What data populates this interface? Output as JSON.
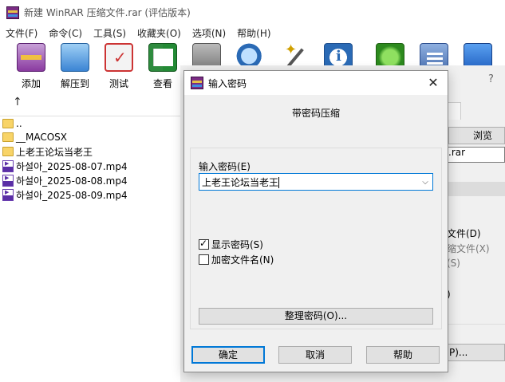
{
  "window": {
    "title": "新建 WinRAR 压缩文件.rar (评估版本)"
  },
  "menu": [
    "文件(F)",
    "命令(C)",
    "工具(S)",
    "收藏夹(O)",
    "选项(N)",
    "帮助(H)"
  ],
  "toolbar": {
    "add": "添加",
    "extract": "解压到",
    "test": "测试",
    "view": "查看"
  },
  "files": [
    {
      "name": "..",
      "type": "folder"
    },
    {
      "name": "__MACOSX",
      "type": "folder"
    },
    {
      "name": "上老王论坛当老王",
      "type": "folder"
    },
    {
      "name": "하설아_2025-08-07.mp4",
      "type": "mp4"
    },
    {
      "name": "하설아_2025-08-08.mp4",
      "type": "mp4"
    },
    {
      "name": "하설아_2025-08-09.mp4",
      "type": "mp4"
    }
  ],
  "background_dialog": {
    "question_mark": "?",
    "browse_button": "浏览(B)",
    "archive_ext": ".rar",
    "option1": "文件(D)",
    "option2": "缩文件(X)",
    "option3": "(S)",
    "option4": ")",
    "p_button": "P)..."
  },
  "password_dialog": {
    "title": "输入密码",
    "close": "✕",
    "heading": "带密码压缩",
    "password_label": "输入密码(E)",
    "password_value": "上老王论坛当老王",
    "show_password": {
      "label": "显示密码(S)",
      "checked": true
    },
    "encrypt_names": {
      "label": "加密文件名(N)",
      "checked": false
    },
    "organize_button": "整理密码(O)...",
    "ok_button": "确定",
    "cancel_button": "取消",
    "help_button": "帮助"
  }
}
